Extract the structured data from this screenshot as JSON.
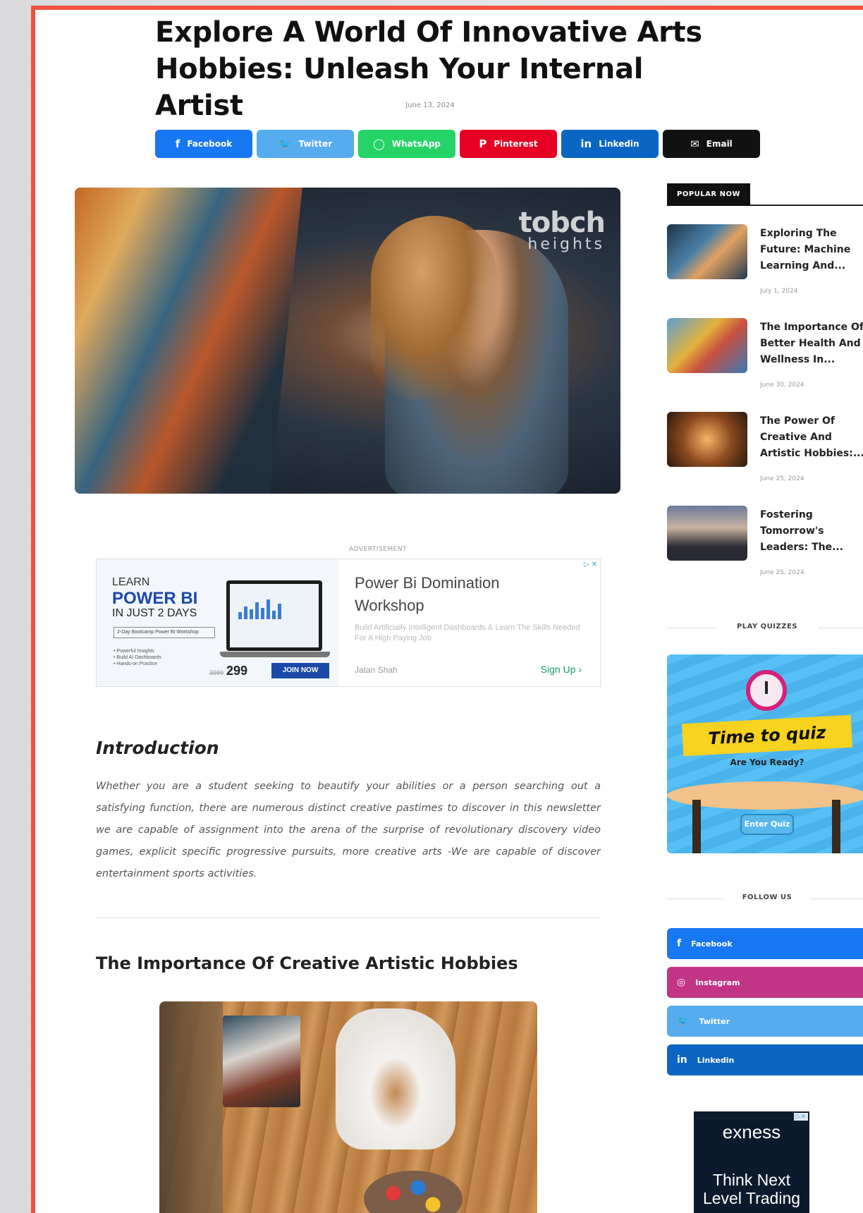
{
  "article": {
    "title": "Explore A World Of Innovative Arts Hobbies: Unleash Your Internal Artist",
    "date": "June 13, 2024"
  },
  "share": [
    {
      "label": "Facebook",
      "icon": "facebook-icon",
      "glyph": "f",
      "color": "#1877f2"
    },
    {
      "label": "Twitter",
      "icon": "twitter-icon",
      "glyph": "🐦",
      "color": "#55acee"
    },
    {
      "label": "WhatsApp",
      "icon": "whatsapp-icon",
      "glyph": "◯",
      "color": "#25d366"
    },
    {
      "label": "Pinterest",
      "icon": "pinterest-icon",
      "glyph": "P",
      "color": "#e60023"
    },
    {
      "label": "Linkedin",
      "icon": "linkedin-icon",
      "glyph": "in",
      "color": "#0a66c2"
    },
    {
      "label": "Email",
      "icon": "email-icon",
      "glyph": "✉",
      "color": "#111111"
    }
  ],
  "hero": {
    "logo_line1": "tobch",
    "logo_line2": "heights"
  },
  "ad": {
    "label": "ADVERTISEMENT",
    "learn": "LEARN",
    "product": "POWER BI",
    "duration": "IN JUST 2 DAYS",
    "tag": "2-Day Bootcamp Power BI Workshop",
    "bullets": "• Powerful Insights\n• Build AI Dashboards\n• Hands-on Practice",
    "old_price": "3999",
    "price": "299",
    "join": "JOIN NOW",
    "headline": "Power Bi Domination Workshop",
    "subtext": "Build Artificially Intelligent Dashboards & Learn The Skills Needed For A High Paying Job",
    "advertiser": "Jatan Shah",
    "cta": "Sign Up ›",
    "adchoices": "▷ ✕"
  },
  "intro": {
    "heading": "Introduction",
    "body": "Whether you are a student seeking to beautify your abilities or a person searching out a satisfying function, there are numerous distinct creative pastimes to discover in this newsletter we are capable of assignment into the arena of the surprise of revolutionary discovery video games, explicit specific progressive pursuits, more creative arts -We are capable of discover entertainment sports activities."
  },
  "section2": {
    "heading": "The Importance Of Creative Artistic Hobbies"
  },
  "sidebar": {
    "popular_label": "POPULAR NOW",
    "popular": [
      {
        "title": "Exploring The Future: Machine Learning And...",
        "date": "July 1, 2024",
        "thumb": "linear-gradient(135deg,#1d3347,#4b7fa6 40%,#e0a060 60%,#223a50)"
      },
      {
        "title": "The Importance Of Better Health And Wellness In...",
        "date": "June 30, 2024",
        "thumb": "linear-gradient(135deg,#5d9fd6,#e4b23c 40%,#c85040 60%,#3b78b8)"
      },
      {
        "title": "The Power Of Creative And Artistic Hobbies:...",
        "date": "June 25, 2024",
        "thumb": "radial-gradient(circle at 50% 50%,#f3b566,#8c4a1e 50%,#2a1a10)"
      },
      {
        "title": "Fostering Tomorrow's Leaders: The...",
        "date": "June 25, 2024",
        "thumb": "linear-gradient(180deg,#6a7a9a,#c9b3a0 40%,#2a2a34 75%)"
      }
    ],
    "quiz_label": "PLAY QUIZZES",
    "quiz": {
      "title": "Time to quiz",
      "subtitle": "Are You Ready?",
      "button": "Enter Quiz"
    },
    "follow_label": "FOLLOW US",
    "follow": [
      {
        "label": "Facebook",
        "icon": "facebook-icon",
        "glyph": "f",
        "color": "#1877f2"
      },
      {
        "label": "Instagram",
        "icon": "instagram-icon",
        "glyph": "◎",
        "color": "#c13584"
      },
      {
        "label": "Twitter",
        "icon": "twitter-icon",
        "glyph": "🐦",
        "color": "#55acee"
      },
      {
        "label": "Linkedin",
        "icon": "linkedin-icon",
        "glyph": "in",
        "color": "#0a66c2"
      }
    ],
    "exness": {
      "brand": "exness",
      "slogan": "Think Next Level Trading",
      "adchoices": "▷✕"
    }
  }
}
